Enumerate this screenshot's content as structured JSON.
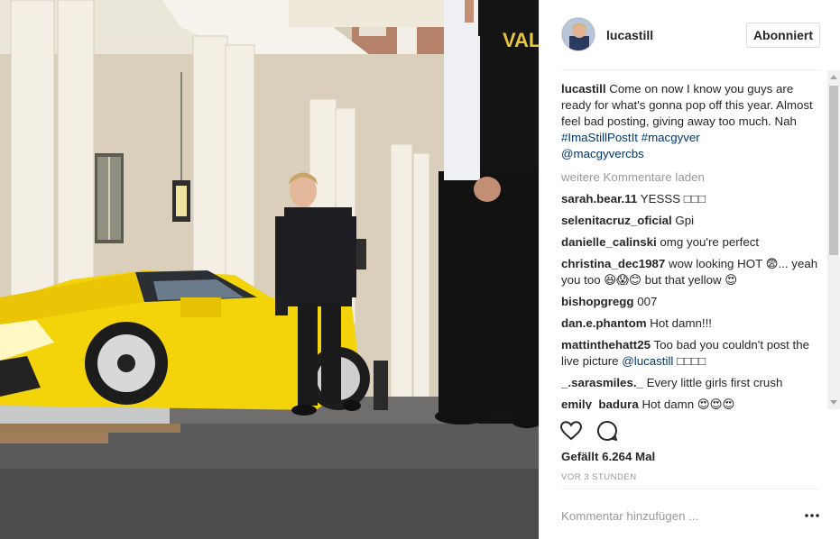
{
  "post": {
    "image_alt": "Photo",
    "author": {
      "username": "lucastill"
    },
    "follow_label": "Abonniert",
    "caption": {
      "username": "lucastill",
      "text": "Come on now I know you guys are ready for what's gonna pop off this year. Almost feel bad posting, giving away too much. Nah ",
      "tags": "#ImaStillPostIt #macgyver",
      "mention": "@macgyvercbs"
    },
    "load_more": "weitere Kommentare laden",
    "comments": [
      {
        "user": "sarah.bear.11",
        "text": "YESSS □□□"
      },
      {
        "user": "selenitacruz_oficial",
        "text": "Gpi"
      },
      {
        "user": "danielle_calinski",
        "text": "omg you're perfect"
      },
      {
        "user": "christina_dec1987",
        "text": "wow looking HOT 😨... yeah you too 😆😱😊 but that yellow 😍"
      },
      {
        "user": "bishopgregg",
        "text": "007"
      },
      {
        "user": "dan.e.phantom",
        "text": "Hot damn!!!"
      },
      {
        "user": "mattinthehatt25",
        "text": "Too bad you couldn't post the live picture ",
        "mention": "@lucastill",
        "suffix": " □□□□"
      },
      {
        "user": "_.sarasmiles._",
        "text": "Every little girls first crush"
      },
      {
        "user": "emily_badura",
        "text": "Hot damn 😍😍😍"
      }
    ],
    "likes": "Gefällt 6.264 Mal",
    "time": "VOR 3 STUNDEN",
    "comment_placeholder": "Kommentar hinzufügen ...",
    "icons": {
      "like": "heart-icon",
      "comment": "comment-icon",
      "more": "more-options-icon"
    },
    "photo_text": "VALE"
  }
}
